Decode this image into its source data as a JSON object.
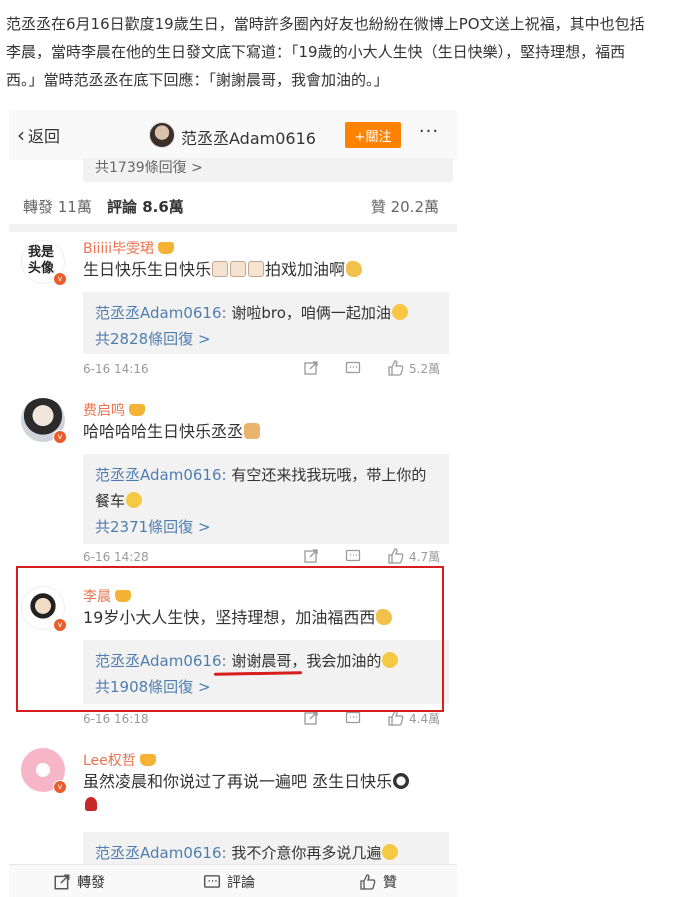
{
  "article": {
    "line1": "范丞丞在6月16日歡度19歲生日，當時許多圈內好友也紛紛在微博上PO文送上祝福，其中也包括",
    "line2": "李晨，當時李晨在他的生日發文底下寫道：「19歲的小大人生快（生日快樂），堅持理想，福西",
    "line3": "西。」當時范丞丞在底下回應：「謝謝晨哥，我會加油的。」"
  },
  "navbar": {
    "back_label": "返回",
    "title": "范丞丞Adam0616",
    "follow_label": "+關注",
    "more_label": "···"
  },
  "top_replies": "共1739條回復 >",
  "tabs": {
    "reposts": "轉發 11萬",
    "comments": "評論 8.6萬",
    "likes": "贊 20.2萬"
  },
  "comments": [
    {
      "avatar_text_1": "我是",
      "avatar_text_2": "头像",
      "username": "Biiiii毕雯珺",
      "text": "生日快乐生日快乐",
      "text_tail": "拍戏加油啊",
      "reply_name": "范丞丞Adam0616:",
      "reply_text": "谢啦bro，咱俩一起加油",
      "reply_count": "共2828條回復 >",
      "time": "6-16 14:16",
      "likes": "5.2萬"
    },
    {
      "username": "费启鸣",
      "text": "哈哈哈哈生日快乐丞丞",
      "reply_name": "范丞丞Adam0616:",
      "reply_text": "有空还来找我玩哦，带上你的",
      "reply_text_2": "餐车",
      "reply_count": "共2371條回復 >",
      "time": "6-16 14:28",
      "likes": "4.7萬"
    },
    {
      "username": "李晨",
      "text": "19岁小大人生快，坚持理想，加油福西西",
      "reply_name": "范丞丞Adam0616:",
      "reply_text": "谢谢晨哥，我会加油的",
      "reply_count": "共1908條回復 >",
      "time": "6-16 16:18",
      "likes": "4.4萬"
    },
    {
      "username": "Lee权哲",
      "text": "虽然凌晨和你说过了再说一遍吧 丞生日快乐",
      "reply_name": "范丞丞Adam0616:",
      "reply_text": "我不介意你再多说几遍"
    }
  ],
  "bottom_bar": {
    "repost": "轉發",
    "comment": "評論",
    "like": "贊"
  },
  "colors": {
    "accent": "#ff8200",
    "username": "#eb7350",
    "link": "#507daf",
    "highlight": "#d61e1e"
  }
}
